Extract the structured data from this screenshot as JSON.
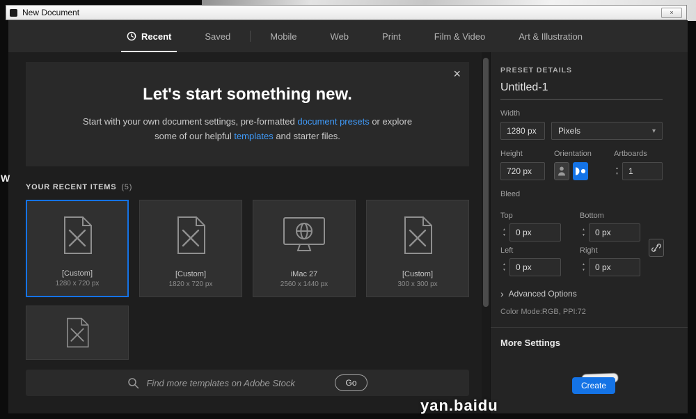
{
  "window": {
    "title": "New Document",
    "background_letter": "W",
    "watermark": "yan.baidu"
  },
  "icons": {
    "close": "×",
    "select_caret": "▾",
    "advanced_caret": "›",
    "step_up": "▲",
    "step_down": "▼"
  },
  "tabs": [
    {
      "label": "Recent"
    },
    {
      "label": "Saved"
    },
    {
      "label": "Mobile"
    },
    {
      "label": "Web"
    },
    {
      "label": "Print"
    },
    {
      "label": "Film & Video"
    },
    {
      "label": "Art & Illustration"
    }
  ],
  "hero": {
    "title": "Let's start something new.",
    "desc_start": "Start with your own document settings, pre-formatted ",
    "link_presets": "document presets",
    "desc_mid": " or explore some of our helpful ",
    "link_templates": "templates",
    "desc_end": " and starter files."
  },
  "recent": {
    "heading": "YOUR RECENT ITEMS",
    "count": "(5)",
    "items": [
      {
        "name": "[Custom]",
        "size": "1280 x 720 px"
      },
      {
        "name": "[Custom]",
        "size": "1820 x 720 px"
      },
      {
        "name": "iMac 27",
        "size": "2560 x 1440 px"
      },
      {
        "name": "[Custom]",
        "size": "300 x 300 px"
      },
      {
        "name": "",
        "size": ""
      }
    ]
  },
  "search": {
    "placeholder": "Find more templates on Adobe Stock",
    "go": "Go"
  },
  "preset": {
    "heading": "PRESET DETAILS",
    "doc_name": "Untitled-1",
    "width_label": "Width",
    "width": "1280 px",
    "units": "Pixels",
    "height_label": "Height",
    "height": "720 px",
    "orientation_label": "Orientation",
    "artboards_label": "Artboards",
    "artboards": "1",
    "bleed_label": "Bleed",
    "bleed": [
      {
        "label": "Top",
        "value": "0 px"
      },
      {
        "label": "Bottom",
        "value": "0 px"
      },
      {
        "label": "Left",
        "value": "0 px"
      },
      {
        "label": "Right",
        "value": "0 px"
      }
    ],
    "advanced": "Advanced Options",
    "color_mode": "Color Mode:RGB, PPI:72",
    "more_settings": "More Settings",
    "create": "Create"
  },
  "colors": {
    "accent": "#1473e6",
    "link": "#3f9bfa"
  }
}
